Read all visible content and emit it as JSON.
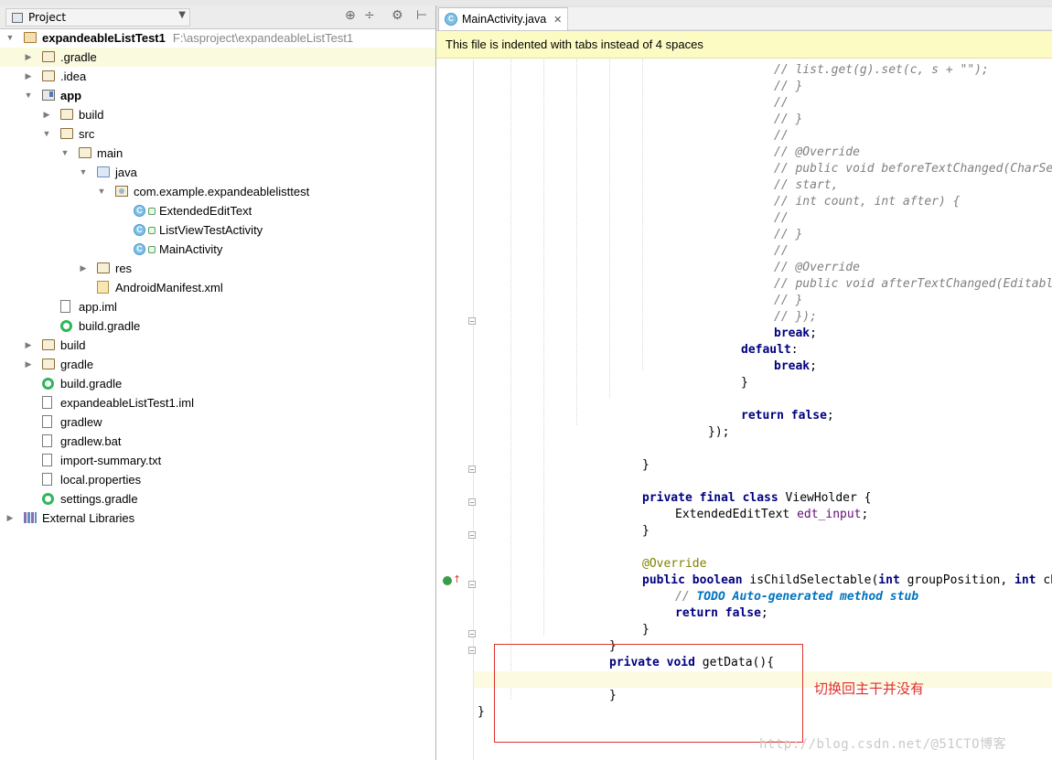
{
  "project_panel": {
    "view_label": "Project",
    "tree": [
      {
        "label": "expandeableListTest1",
        "path": "F:\\asproject\\expandeableListTest1",
        "bold": true,
        "icon": "folder-module-icon",
        "arrow": "down",
        "indent": 0
      },
      {
        "label": ".gradle",
        "icon": "folder-icon",
        "arrow": "right",
        "indent": 1,
        "highlight": true
      },
      {
        "label": ".idea",
        "icon": "folder-icon",
        "arrow": "right",
        "indent": 1
      },
      {
        "label": "app",
        "bold": true,
        "icon": "module-icon",
        "arrow": "down",
        "indent": 1
      },
      {
        "label": "build",
        "icon": "folder-icon",
        "arrow": "right",
        "indent": 2
      },
      {
        "label": "src",
        "icon": "folder-icon",
        "arrow": "down",
        "indent": 2
      },
      {
        "label": "main",
        "icon": "folder-icon",
        "arrow": "down",
        "indent": 3
      },
      {
        "label": "java",
        "icon": "source-folder-icon",
        "arrow": "down",
        "indent": 4
      },
      {
        "label": "com.example.expandeablelisttest",
        "icon": "package-icon",
        "arrow": "down",
        "indent": 5
      },
      {
        "label": "ExtendedEditText",
        "icon": "class-icon",
        "arrow": "",
        "indent": 6
      },
      {
        "label": "ListViewTestActivity",
        "icon": "class-icon",
        "arrow": "",
        "indent": 6
      },
      {
        "label": "MainActivity",
        "icon": "class-icon",
        "arrow": "",
        "indent": 6
      },
      {
        "label": "res",
        "icon": "resource-folder-icon",
        "arrow": "right",
        "indent": 4
      },
      {
        "label": "AndroidManifest.xml",
        "icon": "xml-file-icon",
        "arrow": "",
        "indent": 4
      },
      {
        "label": "app.iml",
        "icon": "iml-file-icon",
        "arrow": "",
        "indent": 2
      },
      {
        "label": "build.gradle",
        "icon": "gradle-icon",
        "arrow": "",
        "indent": 2
      },
      {
        "label": "build",
        "icon": "folder-icon",
        "arrow": "right",
        "indent": 1
      },
      {
        "label": "gradle",
        "icon": "folder-icon",
        "arrow": "right",
        "indent": 1
      },
      {
        "label": "build.gradle",
        "icon": "gradle-icon",
        "arrow": "",
        "indent": 1
      },
      {
        "label": "expandeableListTest1.iml",
        "icon": "iml-file-icon",
        "arrow": "",
        "indent": 1
      },
      {
        "label": "gradlew",
        "icon": "file-icon",
        "arrow": "",
        "indent": 1
      },
      {
        "label": "gradlew.bat",
        "icon": "file-icon",
        "arrow": "",
        "indent": 1
      },
      {
        "label": "import-summary.txt",
        "icon": "text-file-icon",
        "arrow": "",
        "indent": 1
      },
      {
        "label": "local.properties",
        "icon": "properties-file-icon",
        "arrow": "",
        "indent": 1
      },
      {
        "label": "settings.gradle",
        "icon": "gradle-icon",
        "arrow": "",
        "indent": 1
      },
      {
        "label": "External Libraries",
        "icon": "libraries-icon",
        "arrow": "right",
        "indent": 0
      }
    ]
  },
  "editor": {
    "tab_label": "MainActivity.java",
    "notification": "This file is indented with tabs instead of 4 spaces",
    "code_lines": [
      {
        "indent": 36,
        "parts": [
          {
            "t": "// list.get(g).set(c, s + \"\");",
            "c": "cm"
          }
        ]
      },
      {
        "indent": 36,
        "parts": [
          {
            "t": "// }",
            "c": "cm"
          }
        ]
      },
      {
        "indent": 36,
        "parts": [
          {
            "t": "//",
            "c": "cm"
          }
        ]
      },
      {
        "indent": 36,
        "parts": [
          {
            "t": "// }",
            "c": "cm"
          }
        ]
      },
      {
        "indent": 36,
        "parts": [
          {
            "t": "//",
            "c": "cm"
          }
        ]
      },
      {
        "indent": 36,
        "parts": [
          {
            "t": "// @Override",
            "c": "cm"
          }
        ]
      },
      {
        "indent": 36,
        "parts": [
          {
            "t": "// public void beforeTextChanged(CharSequence",
            "c": "cm"
          }
        ]
      },
      {
        "indent": 36,
        "parts": [
          {
            "t": "// start,",
            "c": "cm"
          }
        ]
      },
      {
        "indent": 36,
        "parts": [
          {
            "t": "// int count, int after) {",
            "c": "cm"
          }
        ]
      },
      {
        "indent": 36,
        "parts": [
          {
            "t": "//",
            "c": "cm"
          }
        ]
      },
      {
        "indent": 36,
        "parts": [
          {
            "t": "// }",
            "c": "cm"
          }
        ]
      },
      {
        "indent": 36,
        "parts": [
          {
            "t": "//",
            "c": "cm"
          }
        ]
      },
      {
        "indent": 36,
        "parts": [
          {
            "t": "// @Override",
            "c": "cm"
          }
        ]
      },
      {
        "indent": 36,
        "parts": [
          {
            "t": "// public void afterTextChanged(Editable s) {",
            "c": "cm"
          }
        ]
      },
      {
        "indent": 36,
        "parts": [
          {
            "t": "// }",
            "c": "cm"
          }
        ]
      },
      {
        "indent": 36,
        "parts": [
          {
            "t": "// });",
            "c": "cm"
          }
        ]
      },
      {
        "indent": 36,
        "parts": [
          {
            "t": "break",
            "c": "kw"
          },
          {
            "t": ";",
            "c": ""
          }
        ]
      },
      {
        "indent": 32,
        "parts": [
          {
            "t": "default",
            "c": "kw"
          },
          {
            "t": ":",
            "c": ""
          }
        ]
      },
      {
        "indent": 36,
        "parts": [
          {
            "t": "break",
            "c": "kw"
          },
          {
            "t": ";",
            "c": ""
          }
        ]
      },
      {
        "indent": 32,
        "parts": [
          {
            "t": "}",
            "c": ""
          }
        ]
      },
      {
        "indent": 0,
        "parts": []
      },
      {
        "indent": 32,
        "parts": [
          {
            "t": "return false",
            "c": "kw"
          },
          {
            "t": ";",
            "c": ""
          }
        ]
      },
      {
        "indent": 28,
        "parts": [
          {
            "t": "});",
            "c": ""
          }
        ]
      },
      {
        "indent": 0,
        "parts": []
      },
      {
        "indent": 20,
        "parts": [
          {
            "t": "}",
            "c": ""
          }
        ]
      },
      {
        "indent": 0,
        "parts": []
      },
      {
        "indent": 20,
        "parts": [
          {
            "t": "private final class ",
            "c": "kw"
          },
          {
            "t": "ViewHolder {",
            "c": ""
          }
        ]
      },
      {
        "indent": 24,
        "parts": [
          {
            "t": "ExtendedEditText ",
            "c": ""
          },
          {
            "t": "edt_input",
            "c": "fld"
          },
          {
            "t": ";",
            "c": ""
          }
        ]
      },
      {
        "indent": 20,
        "parts": [
          {
            "t": "}",
            "c": ""
          }
        ]
      },
      {
        "indent": 0,
        "parts": []
      },
      {
        "indent": 20,
        "parts": [
          {
            "t": "@Override",
            "c": "ann"
          }
        ]
      },
      {
        "indent": 20,
        "parts": [
          {
            "t": "public boolean ",
            "c": "kw"
          },
          {
            "t": "isChildSelectable(",
            "c": ""
          },
          {
            "t": "int ",
            "c": "kw"
          },
          {
            "t": "groupPosition, ",
            "c": ""
          },
          {
            "t": "int ",
            "c": "kw"
          },
          {
            "t": "childP",
            "c": ""
          }
        ]
      },
      {
        "indent": 24,
        "parts": [
          {
            "t": "// ",
            "c": "cm"
          },
          {
            "t": "TODO Auto-generated method stub",
            "c": "todo"
          }
        ]
      },
      {
        "indent": 24,
        "parts": [
          {
            "t": "return false",
            "c": "kw"
          },
          {
            "t": ";",
            "c": ""
          }
        ]
      },
      {
        "indent": 20,
        "parts": [
          {
            "t": "}",
            "c": ""
          }
        ]
      },
      {
        "indent": 16,
        "parts": [
          {
            "t": "}",
            "c": ""
          }
        ]
      },
      {
        "indent": 16,
        "parts": [
          {
            "t": "private void ",
            "c": "kw"
          },
          {
            "t": "getData(){",
            "c": ""
          }
        ]
      },
      {
        "indent": 0,
        "parts": [],
        "caret": true
      },
      {
        "indent": 16,
        "parts": [
          {
            "t": "}",
            "c": ""
          }
        ]
      },
      {
        "indent": 0,
        "parts": [
          {
            "t": "}",
            "c": ""
          }
        ]
      }
    ]
  },
  "annotation": {
    "text": "切换回主干并没有",
    "color": "#e0302c"
  },
  "watermark": {
    "text": "http://blog.csdn.net/@51CTO博客"
  }
}
